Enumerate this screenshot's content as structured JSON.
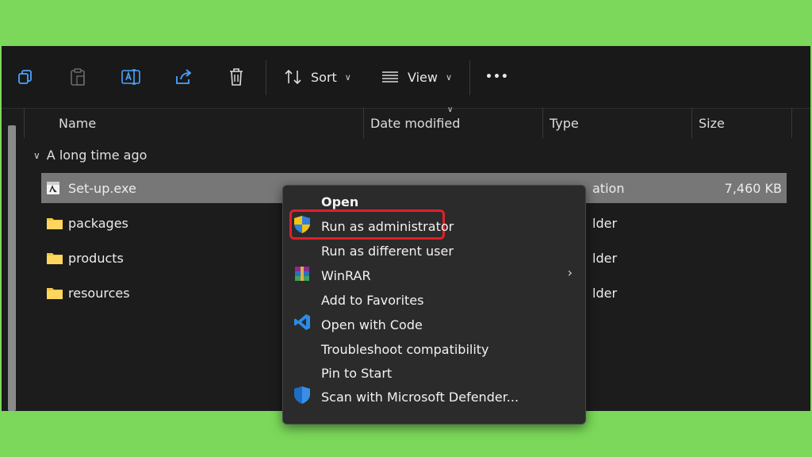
{
  "toolbar": {
    "sort_label": "Sort",
    "view_label": "View",
    "more_label": "•••"
  },
  "columns": {
    "name": "Name",
    "date_modified": "Date modified",
    "type": "Type",
    "size": "Size"
  },
  "group": {
    "label": "A long time ago"
  },
  "rows": [
    {
      "name": "Set-up.exe",
      "type": "ation",
      "size": "7,460 KB"
    },
    {
      "name": "packages",
      "type": "lder",
      "size": ""
    },
    {
      "name": "products",
      "type": "lder",
      "size": ""
    },
    {
      "name": "resources",
      "type": "lder",
      "size": ""
    }
  ],
  "context_menu": {
    "items": [
      {
        "label": "Open"
      },
      {
        "label": "Run as administrator"
      },
      {
        "label": "Run as different user"
      },
      {
        "label": "WinRAR"
      },
      {
        "label": "Add to Favorites"
      },
      {
        "label": "Open with Code"
      },
      {
        "label": "Troubleshoot compatibility"
      },
      {
        "label": "Pin to Start"
      },
      {
        "label": "Scan with Microsoft Defender..."
      }
    ],
    "highlight_color": "#e0202a"
  },
  "colors": {
    "background": "#7bd85a",
    "window": "#1c1c1c",
    "menu": "#2b2b2b",
    "selected_row": "#777777"
  }
}
